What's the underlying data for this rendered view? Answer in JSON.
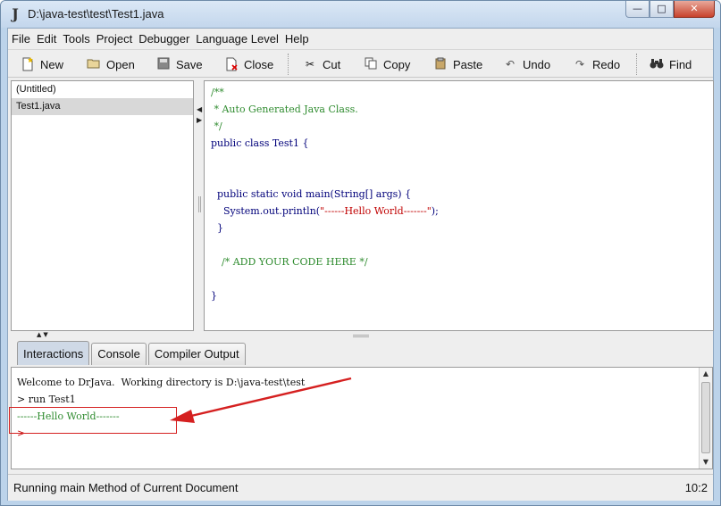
{
  "window": {
    "title": "D:\\java-test\\test\\Test1.java",
    "app_icon_letter": "J",
    "controls": {
      "minimize": "—",
      "maximize": "□",
      "close": "✕"
    }
  },
  "menu": [
    "File",
    "Edit",
    "Tools",
    "Project",
    "Debugger",
    "Language Level",
    "Help"
  ],
  "toolbar": {
    "new": "New",
    "open": "Open",
    "save": "Save",
    "close": "Close",
    "cut": "Cut",
    "copy": "Copy",
    "paste": "Paste",
    "undo": "Undo",
    "redo": "Redo",
    "find": "Find"
  },
  "files": [
    {
      "name": "(Untitled)",
      "selected": false
    },
    {
      "name": "Test1.java",
      "selected": true
    }
  ],
  "editor": {
    "lines": [
      "/**",
      " * Auto Generated Java Class.",
      " */",
      "public class Test1 {",
      "",
      "",
      "  public static void main(String[] args) {",
      "    System.out.println(",
      "\"------Hello World-------\"",
      ");",
      "  }",
      "/* ADD YOUR CODE HERE */",
      "}"
    ]
  },
  "tabs": [
    "Interactions",
    "Console",
    "Compiler Output"
  ],
  "console": {
    "welcome": "Welcome to DrJava.  Working directory is D:\\java-test\\test",
    "prompt": ">",
    "command": "run Test1",
    "output": "------Hello World-------",
    "prompt2": ">"
  },
  "status": {
    "message": "Running main Method of Current Document",
    "position": "10:2"
  },
  "colors": {
    "comment": "#2e8b2e",
    "keyword": "#00007a",
    "string": "#c00000",
    "annotation": "#d52020"
  }
}
